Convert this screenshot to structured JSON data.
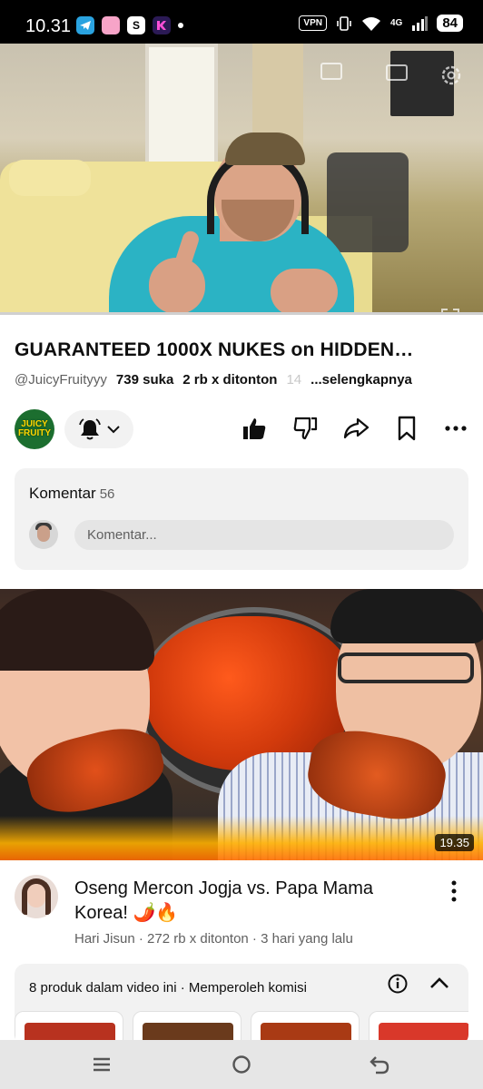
{
  "status_bar": {
    "time": "10.31",
    "notification_icons": [
      "telegram-icon",
      "pink-app-icon",
      "shopee-icon",
      "kick-icon"
    ],
    "pink_app_text": "",
    "shopee_text": "S",
    "vpn": "VPN",
    "network": "4G",
    "battery": "84"
  },
  "player": {
    "progress_fraction": 0.0
  },
  "video": {
    "title": "GUARANTEED 1000X NUKES on HIDDEN…",
    "channel_handle": "@JuicyFruityyy",
    "likes": "739 suka",
    "views": "2 rb x ditonton",
    "age_fragment": "14",
    "more_link": "...selengkapnya"
  },
  "channel": {
    "avatar_line1": "JUICY",
    "avatar_line2": "FRUITY"
  },
  "actions": {
    "bell": "bell-icon",
    "like": "thumbs-up-icon",
    "dislike": "thumbs-down-icon",
    "share": "share-icon",
    "save": "bookmark-icon",
    "more": "more-icon"
  },
  "comments": {
    "label": "Komentar",
    "count": "56",
    "placeholder": "Komentar..."
  },
  "recommended": {
    "duration": "19.35",
    "title": "Oseng Mercon Jogja vs. Papa Mama Korea! 🌶️🔥",
    "meta": "Hari Jisun · 272 rb x ditonton · 3 hari yang lalu"
  },
  "products": {
    "header": "8 produk dalam video ini · Memperoleh komisi",
    "card_colors": [
      "#b8321f",
      "#6a3a1c",
      "#a93a14",
      "#d9382a"
    ]
  },
  "nav_bar": {
    "recents": "menu-icon",
    "home": "home-circle-icon",
    "back": "back-icon"
  }
}
